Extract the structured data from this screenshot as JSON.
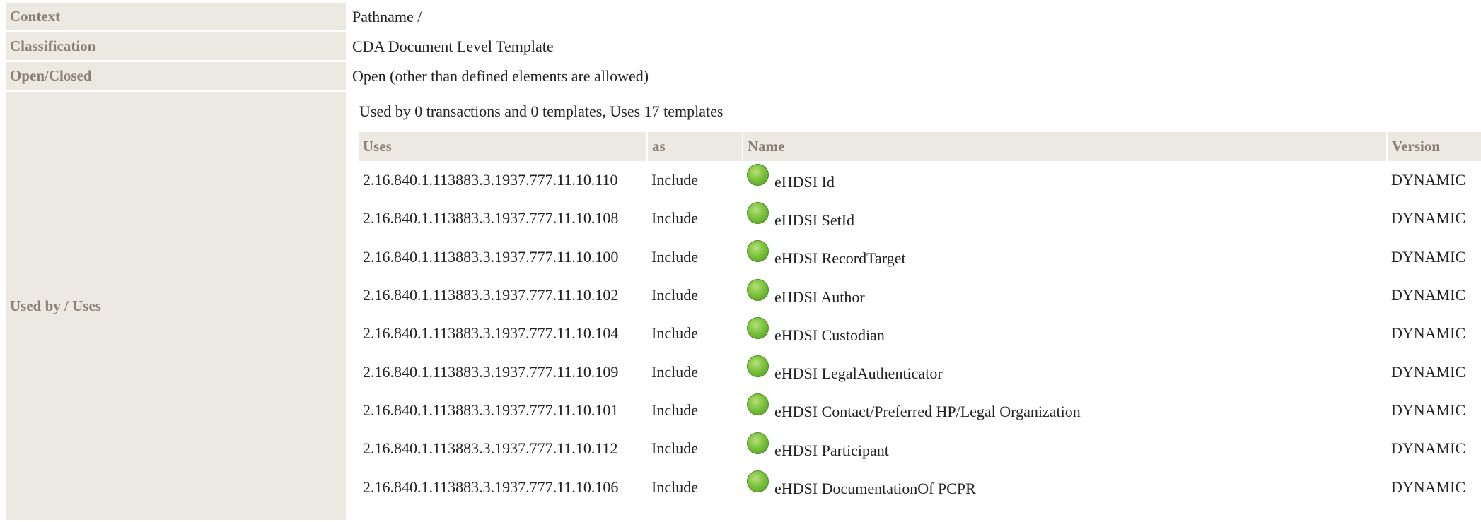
{
  "props": {
    "context": {
      "label": "Context",
      "value": "Pathname /"
    },
    "classification": {
      "label": "Classification",
      "value": "CDA Document Level Template"
    },
    "open_closed": {
      "label": "Open/Closed",
      "value": "Open (other than defined elements are allowed)"
    },
    "used_by": {
      "label": "Used by / Uses"
    }
  },
  "uses": {
    "summary": "Used by 0 transactions and 0 templates, Uses 17 templates",
    "headers": {
      "uses": "Uses",
      "as": "as",
      "name": "Name",
      "version": "Version"
    },
    "status_color": "#7cc23d",
    "rows": [
      {
        "oid": "2.16.840.1.113883.3.1937.777.11.10.110",
        "as": "Include",
        "name": "eHDSI Id",
        "version": "DYNAMIC"
      },
      {
        "oid": "2.16.840.1.113883.3.1937.777.11.10.108",
        "as": "Include",
        "name": "eHDSI SetId",
        "version": "DYNAMIC"
      },
      {
        "oid": "2.16.840.1.113883.3.1937.777.11.10.100",
        "as": "Include",
        "name": "eHDSI RecordTarget",
        "version": "DYNAMIC"
      },
      {
        "oid": "2.16.840.1.113883.3.1937.777.11.10.102",
        "as": "Include",
        "name": "eHDSI Author",
        "version": "DYNAMIC"
      },
      {
        "oid": "2.16.840.1.113883.3.1937.777.11.10.104",
        "as": "Include",
        "name": "eHDSI Custodian",
        "version": "DYNAMIC"
      },
      {
        "oid": "2.16.840.1.113883.3.1937.777.11.10.109",
        "as": "Include",
        "name": "eHDSI LegalAuthenticator",
        "version": "DYNAMIC"
      },
      {
        "oid": "2.16.840.1.113883.3.1937.777.11.10.101",
        "as": "Include",
        "name": "eHDSI Contact/Preferred HP/Legal Organization",
        "version": "DYNAMIC"
      },
      {
        "oid": "2.16.840.1.113883.3.1937.777.11.10.112",
        "as": "Include",
        "name": "eHDSI Participant",
        "version": "DYNAMIC"
      },
      {
        "oid": "2.16.840.1.113883.3.1937.777.11.10.106",
        "as": "Include",
        "name": "eHDSI DocumentationOf PCPR",
        "version": "DYNAMIC"
      }
    ]
  }
}
